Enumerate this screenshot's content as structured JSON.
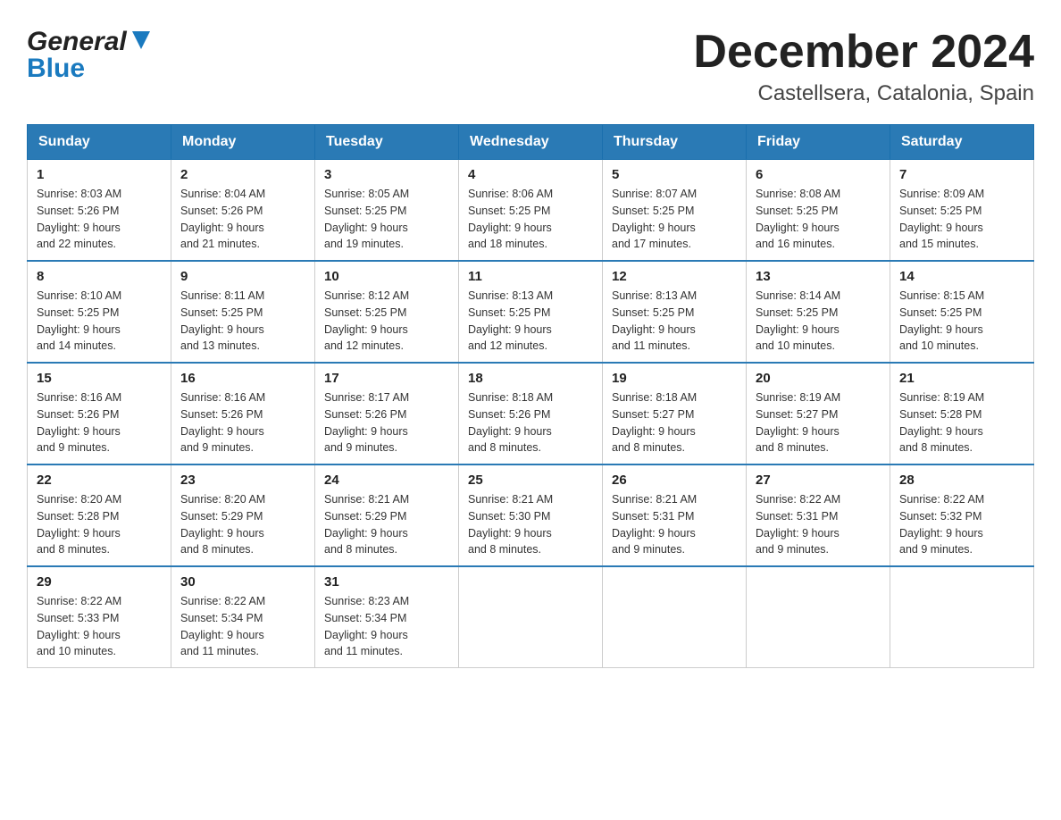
{
  "header": {
    "logo_general": "General",
    "logo_blue": "Blue",
    "title": "December 2024",
    "subtitle": "Castellsera, Catalonia, Spain"
  },
  "calendar": {
    "days_of_week": [
      "Sunday",
      "Monday",
      "Tuesday",
      "Wednesday",
      "Thursday",
      "Friday",
      "Saturday"
    ],
    "weeks": [
      [
        {
          "day": "1",
          "sunrise": "8:03 AM",
          "sunset": "5:26 PM",
          "daylight": "9 hours and 22 minutes."
        },
        {
          "day": "2",
          "sunrise": "8:04 AM",
          "sunset": "5:26 PM",
          "daylight": "9 hours and 21 minutes."
        },
        {
          "day": "3",
          "sunrise": "8:05 AM",
          "sunset": "5:25 PM",
          "daylight": "9 hours and 19 minutes."
        },
        {
          "day": "4",
          "sunrise": "8:06 AM",
          "sunset": "5:25 PM",
          "daylight": "9 hours and 18 minutes."
        },
        {
          "day": "5",
          "sunrise": "8:07 AM",
          "sunset": "5:25 PM",
          "daylight": "9 hours and 17 minutes."
        },
        {
          "day": "6",
          "sunrise": "8:08 AM",
          "sunset": "5:25 PM",
          "daylight": "9 hours and 16 minutes."
        },
        {
          "day": "7",
          "sunrise": "8:09 AM",
          "sunset": "5:25 PM",
          "daylight": "9 hours and 15 minutes."
        }
      ],
      [
        {
          "day": "8",
          "sunrise": "8:10 AM",
          "sunset": "5:25 PM",
          "daylight": "9 hours and 14 minutes."
        },
        {
          "day": "9",
          "sunrise": "8:11 AM",
          "sunset": "5:25 PM",
          "daylight": "9 hours and 13 minutes."
        },
        {
          "day": "10",
          "sunrise": "8:12 AM",
          "sunset": "5:25 PM",
          "daylight": "9 hours and 12 minutes."
        },
        {
          "day": "11",
          "sunrise": "8:13 AM",
          "sunset": "5:25 PM",
          "daylight": "9 hours and 12 minutes."
        },
        {
          "day": "12",
          "sunrise": "8:13 AM",
          "sunset": "5:25 PM",
          "daylight": "9 hours and 11 minutes."
        },
        {
          "day": "13",
          "sunrise": "8:14 AM",
          "sunset": "5:25 PM",
          "daylight": "9 hours and 10 minutes."
        },
        {
          "day": "14",
          "sunrise": "8:15 AM",
          "sunset": "5:25 PM",
          "daylight": "9 hours and 10 minutes."
        }
      ],
      [
        {
          "day": "15",
          "sunrise": "8:16 AM",
          "sunset": "5:26 PM",
          "daylight": "9 hours and 9 minutes."
        },
        {
          "day": "16",
          "sunrise": "8:16 AM",
          "sunset": "5:26 PM",
          "daylight": "9 hours and 9 minutes."
        },
        {
          "day": "17",
          "sunrise": "8:17 AM",
          "sunset": "5:26 PM",
          "daylight": "9 hours and 9 minutes."
        },
        {
          "day": "18",
          "sunrise": "8:18 AM",
          "sunset": "5:26 PM",
          "daylight": "9 hours and 8 minutes."
        },
        {
          "day": "19",
          "sunrise": "8:18 AM",
          "sunset": "5:27 PM",
          "daylight": "9 hours and 8 minutes."
        },
        {
          "day": "20",
          "sunrise": "8:19 AM",
          "sunset": "5:27 PM",
          "daylight": "9 hours and 8 minutes."
        },
        {
          "day": "21",
          "sunrise": "8:19 AM",
          "sunset": "5:28 PM",
          "daylight": "9 hours and 8 minutes."
        }
      ],
      [
        {
          "day": "22",
          "sunrise": "8:20 AM",
          "sunset": "5:28 PM",
          "daylight": "9 hours and 8 minutes."
        },
        {
          "day": "23",
          "sunrise": "8:20 AM",
          "sunset": "5:29 PM",
          "daylight": "9 hours and 8 minutes."
        },
        {
          "day": "24",
          "sunrise": "8:21 AM",
          "sunset": "5:29 PM",
          "daylight": "9 hours and 8 minutes."
        },
        {
          "day": "25",
          "sunrise": "8:21 AM",
          "sunset": "5:30 PM",
          "daylight": "9 hours and 8 minutes."
        },
        {
          "day": "26",
          "sunrise": "8:21 AM",
          "sunset": "5:31 PM",
          "daylight": "9 hours and 9 minutes."
        },
        {
          "day": "27",
          "sunrise": "8:22 AM",
          "sunset": "5:31 PM",
          "daylight": "9 hours and 9 minutes."
        },
        {
          "day": "28",
          "sunrise": "8:22 AM",
          "sunset": "5:32 PM",
          "daylight": "9 hours and 9 minutes."
        }
      ],
      [
        {
          "day": "29",
          "sunrise": "8:22 AM",
          "sunset": "5:33 PM",
          "daylight": "9 hours and 10 minutes."
        },
        {
          "day": "30",
          "sunrise": "8:22 AM",
          "sunset": "5:34 PM",
          "daylight": "9 hours and 11 minutes."
        },
        {
          "day": "31",
          "sunrise": "8:23 AM",
          "sunset": "5:34 PM",
          "daylight": "9 hours and 11 minutes."
        },
        null,
        null,
        null,
        null
      ]
    ],
    "labels": {
      "sunrise": "Sunrise:",
      "sunset": "Sunset:",
      "daylight": "Daylight:"
    }
  }
}
